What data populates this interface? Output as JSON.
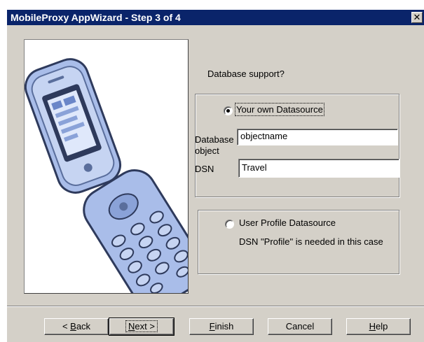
{
  "window": {
    "title": "MobileProxy AppWizard - Step 3 of 4",
    "close_glyph": "✕"
  },
  "question": "Database support?",
  "own_datasource": {
    "label": "Your own Datasource",
    "selected": true,
    "database_object_label_line1": "Database",
    "database_object_label_line2": "object",
    "database_object_value": "objectname",
    "dsn_label": "DSN",
    "dsn_value": "Travel"
  },
  "profile_datasource": {
    "label": "User Profile Datasource",
    "selected": false,
    "note": "DSN \"Profile\" is needed in this case"
  },
  "buttons": {
    "back_prefix": "< ",
    "back_key": "B",
    "back_rest": "ack",
    "next_key": "N",
    "next_rest": "ext >",
    "finish_key": "F",
    "finish_rest": "inish",
    "cancel": "Cancel",
    "help_key": "H",
    "help_rest": "elp"
  },
  "colors": {
    "titlebar": "#0a246a",
    "dialog_face": "#d4d0c8",
    "phone_body": "#a9bde9",
    "phone_dark": "#2e3a5c"
  },
  "image": {
    "subject": "flip-phone-icon"
  }
}
